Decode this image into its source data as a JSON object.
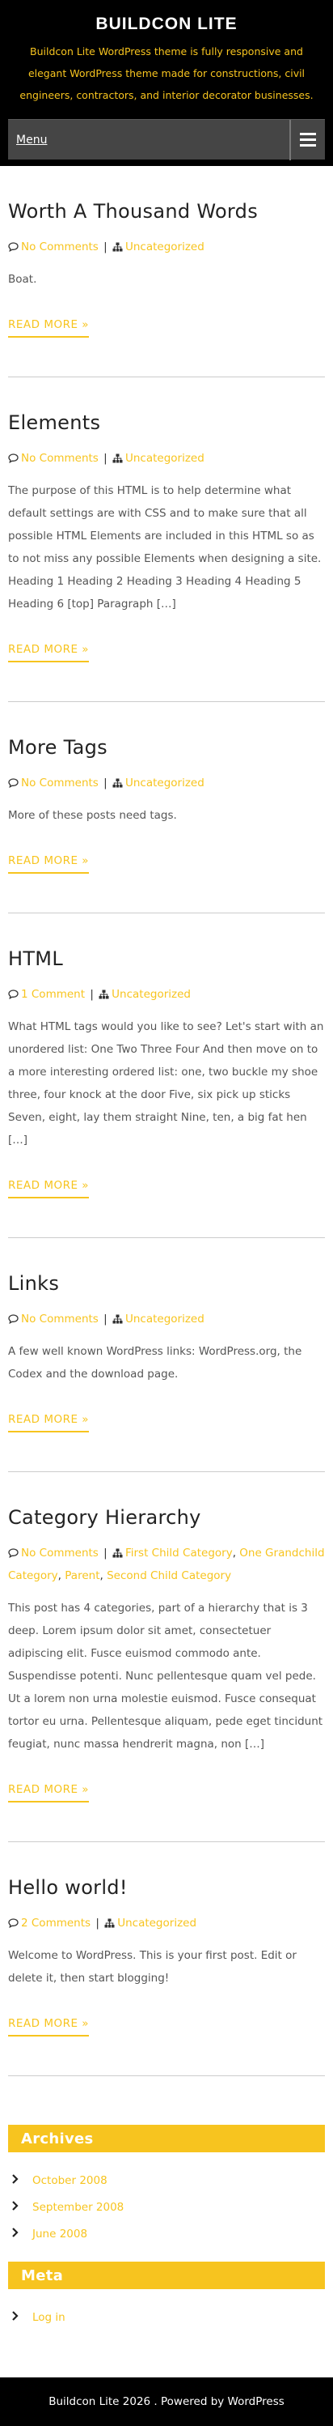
{
  "site": {
    "title": "BUILDCON LITE",
    "description": "Buildcon Lite WordPress theme is fully responsive and elegant WordPress theme made for constructions, civil engineers, contractors, and interior decorator businesses."
  },
  "nav": {
    "menu_label": "Menu"
  },
  "posts": [
    {
      "title": "Worth A Thousand Words",
      "comments": "No Comments",
      "categories": [
        "Uncategorized"
      ],
      "excerpt": "Boat.",
      "read_more": "READ MORE »"
    },
    {
      "title": "Elements",
      "comments": "No Comments",
      "categories": [
        "Uncategorized"
      ],
      "excerpt": "The purpose of this HTML is to help determine what default settings are with CSS and to make sure that all possible HTML Elements are included in this HTML so as to not miss any possible Elements when designing a site. Heading 1 Heading 2 Heading 3 Heading 4 Heading 5 Heading 6 [top] Paragraph […]",
      "read_more": "READ MORE »"
    },
    {
      "title": "More Tags",
      "comments": "No Comments",
      "categories": [
        "Uncategorized"
      ],
      "excerpt": "More of these posts need tags.",
      "read_more": "READ MORE »"
    },
    {
      "title": "HTML",
      "comments": "1 Comment",
      "categories": [
        "Uncategorized"
      ],
      "excerpt": "What HTML tags would you like to see? Let's start with an unordered list: One Two Three Four And then move on to a more interesting ordered list: one, two buckle my shoe three, four knock at the door Five, six pick up sticks Seven, eight, lay them straight Nine, ten, a big fat hen […]",
      "read_more": "READ MORE »"
    },
    {
      "title": "Links",
      "comments": "No Comments",
      "categories": [
        "Uncategorized"
      ],
      "excerpt": "A few well known WordPress links: WordPress.org, the Codex and the download page.",
      "read_more": "READ MORE »"
    },
    {
      "title": "Category Hierarchy",
      "comments": "No Comments",
      "categories": [
        "First Child Category",
        "One Grandchild Category",
        "Parent",
        "Second Child Category"
      ],
      "excerpt": "This post has 4 categories, part of a hierarchy that is 3 deep. Lorem ipsum dolor sit amet, consectetuer adipiscing elit. Fusce euismod commodo ante. Suspendisse potenti. Nunc pellentesque quam vel pede. Ut a lorem non urna molestie euismod. Fusce consequat tortor eu urna. Pellentesque aliquam, pede eget tincidunt feugiat, nunc massa hendrerit magna, non […]",
      "read_more": "READ MORE »"
    },
    {
      "title": "Hello world!",
      "comments": "2 Comments",
      "categories": [
        "Uncategorized"
      ],
      "excerpt": "Welcome to WordPress. This is your first post. Edit or delete it, then start blogging!",
      "read_more": "READ MORE »"
    }
  ],
  "sidebar": {
    "archives": {
      "title": "Archives",
      "items": [
        "October 2008",
        "September 2008",
        "June 2008"
      ]
    },
    "meta": {
      "title": "Meta",
      "items": [
        "Log in"
      ]
    }
  },
  "footer": {
    "text": "Buildcon Lite 2026 . Powered by WordPress"
  },
  "colors": {
    "accent": "#f7c41f",
    "header_bg": "#000000",
    "menu_bg": "#454545"
  },
  "icons": {
    "comments": "comments-icon",
    "category": "sitemap-icon",
    "list_bullet": "chevron-right-icon",
    "menu": "hamburger-icon"
  }
}
